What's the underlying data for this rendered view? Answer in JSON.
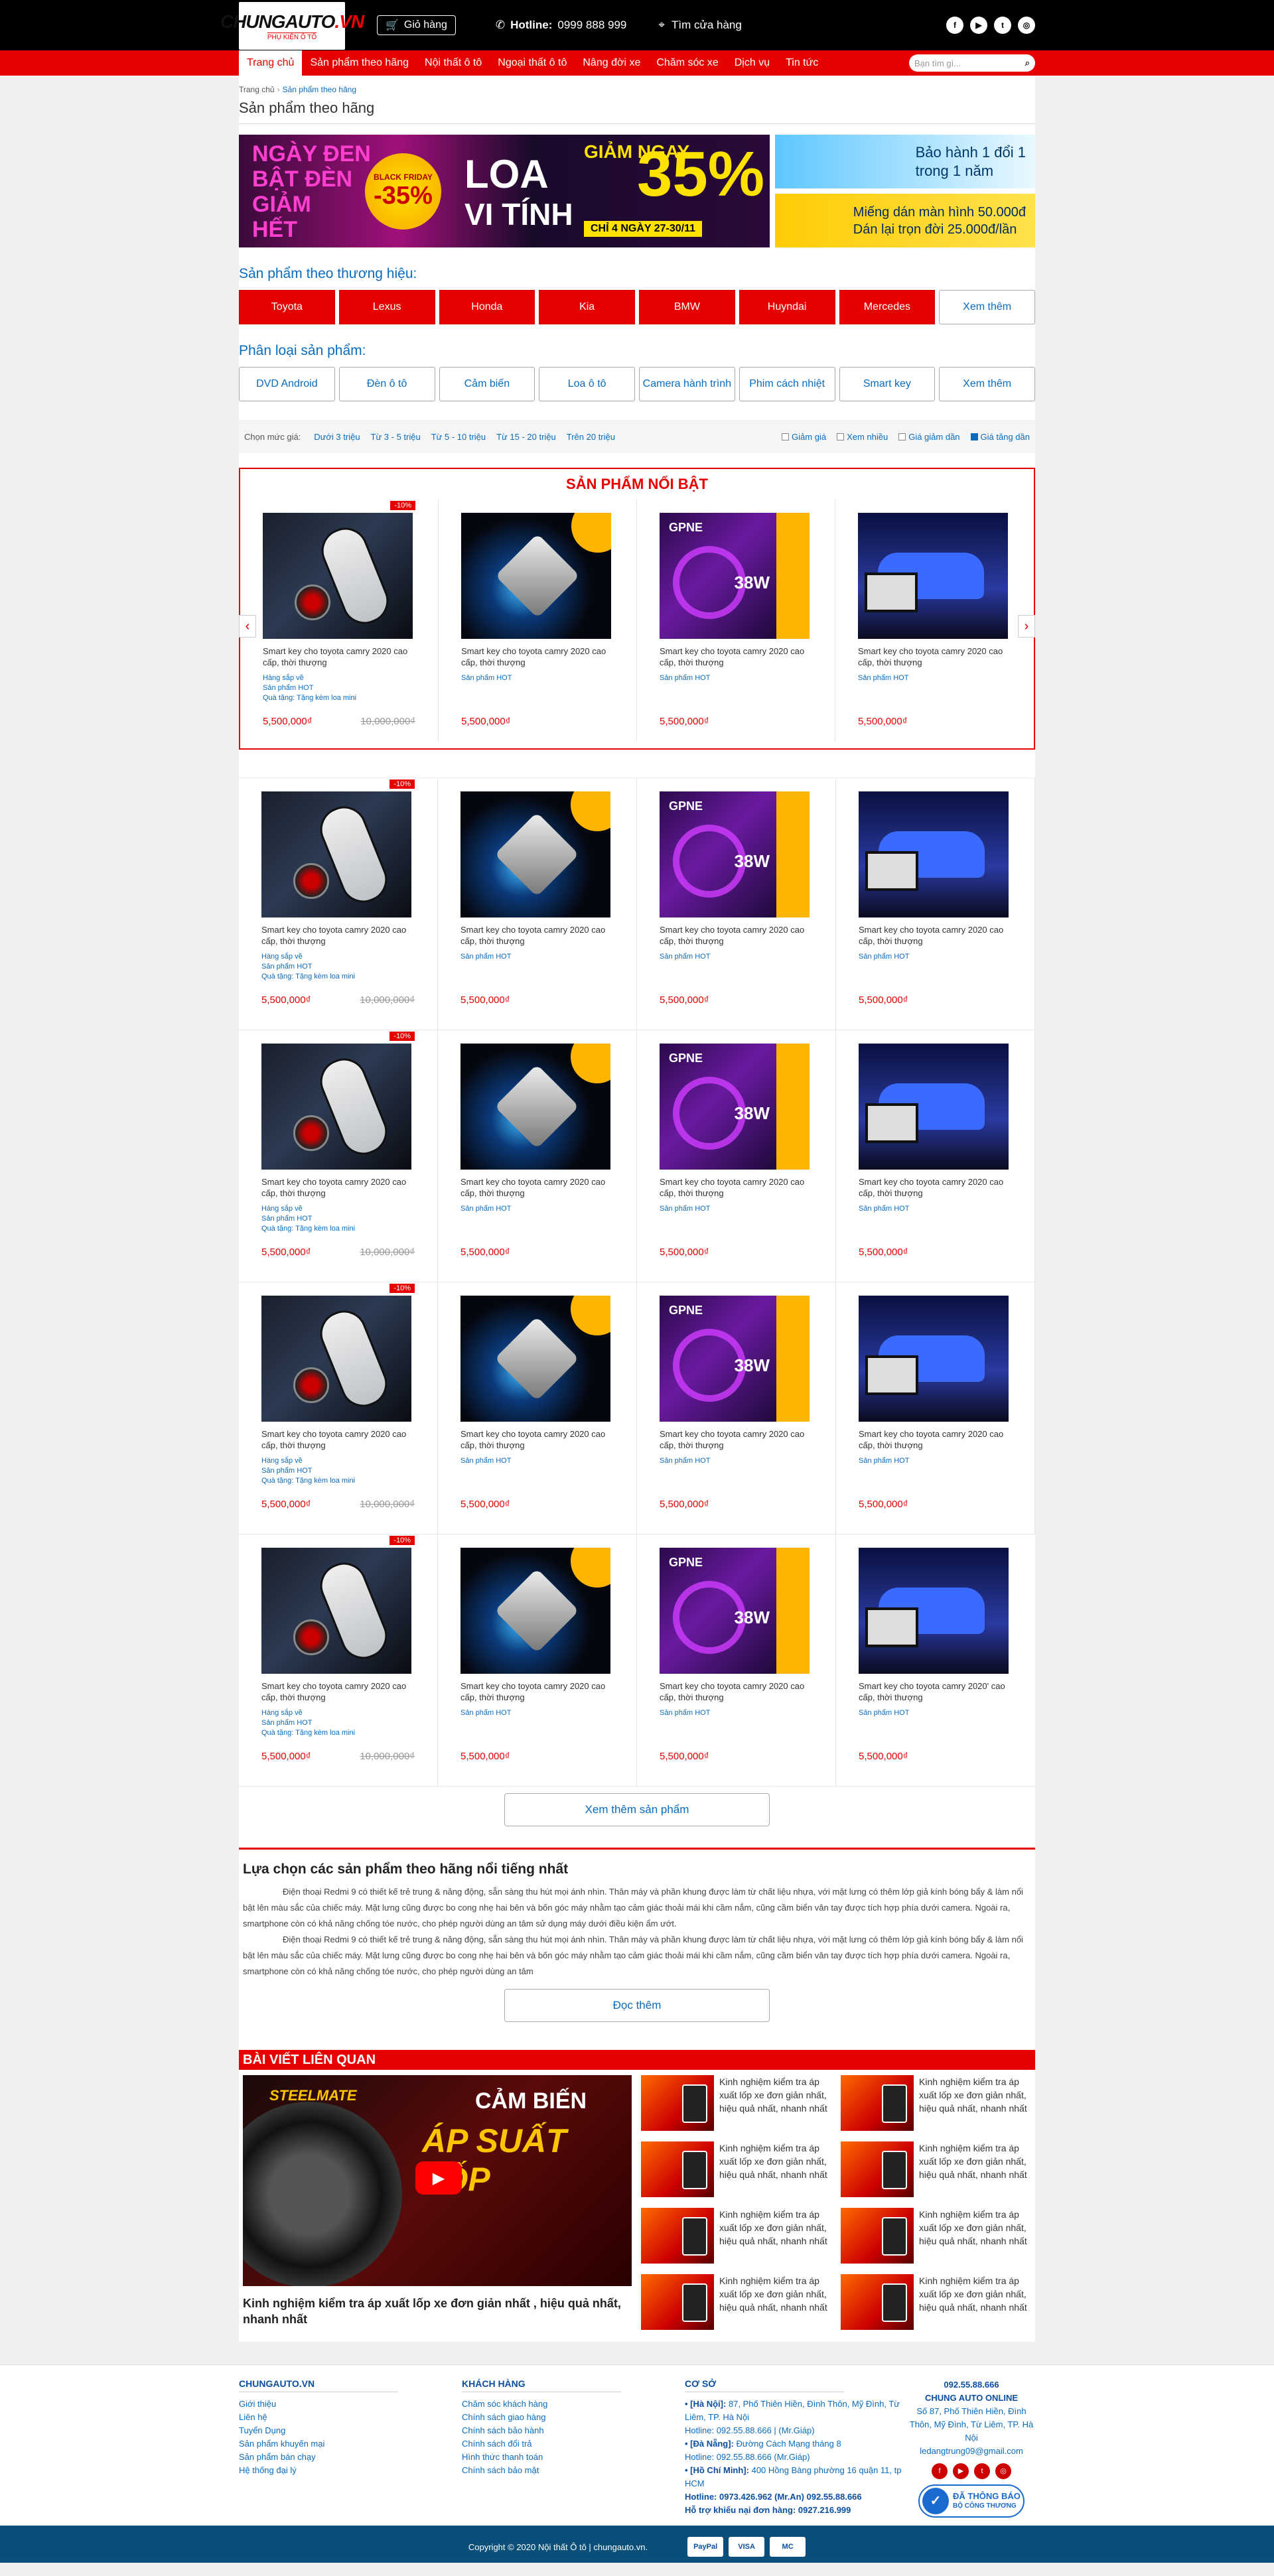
{
  "header": {
    "logo_main_1": "CHUNGAUTO",
    "logo_main_2": ".VN",
    "logo_sub": "PHỤ KIỆN Ô TÔ",
    "cart_label": "Giỏ hàng",
    "hotline_label": "Hotline:",
    "hotline_number": "0999 888 999",
    "store_label": "Tìm cửa hàng",
    "socials": [
      "f",
      "▶",
      "t",
      "◎"
    ]
  },
  "nav": {
    "items": [
      "Trang chủ",
      "Sản phẩm theo hãng",
      "Nội thất ô tô",
      "Ngoại thất ô tô",
      "Nâng đời xe",
      "Chăm sóc xe",
      "Dịch vụ",
      "Tin tức"
    ],
    "search_placeholder": "Bạn tìm gì..."
  },
  "breadcrumb": {
    "home": "Trang chủ",
    "current": "Sản phẩm theo hãng"
  },
  "page_title": "Sản phẩm theo hãng",
  "banner": {
    "big_l1": "NGÀY ĐEN",
    "big_l2": "BẬT ĐÈN",
    "big_l3": "GIẢM",
    "big_l4": "HẾT",
    "big_badge": "-35%",
    "big_badge_sub": "BLACK FRIDAY",
    "big_loa": "LOA",
    "big_vitinh": "VI TÍNH",
    "big_giam": "GIẢM NGAY",
    "big_pct": "35%",
    "big_date": "CHỈ 4 NGÀY 27-30/11",
    "s1_l1": "Bảo hành 1 đổi 1",
    "s1_l2": "trong 1 năm",
    "s2_l1": "Miếng dán màn hình 50.000đ",
    "s2_l2": "Dán lại trọn đời 25.000đ/lần"
  },
  "brands_title": "Sản phẩm theo thương hiệu:",
  "brands": [
    "Toyota",
    "Lexus",
    "Honda",
    "Kia",
    "BMW",
    "Huyndai",
    "Mercedes"
  ],
  "brands_more": "Xem thêm",
  "cats_title": "Phân loại sản phẩm:",
  "cats": [
    "DVD Android",
    "Đèn ô tô",
    "Cảm biến",
    "Loa ô tô",
    "Camera hành trình",
    "Phim cách nhiệt",
    "Smart key",
    "Xem thêm"
  ],
  "filter": {
    "label": "Chọn mức giá:",
    "ranges": [
      "Dưới 3 triệu",
      "Từ 3 - 5 triệu",
      "Từ 5 - 10 triệu",
      "Từ 15 - 20 triệu",
      "Trên 20 triệu"
    ],
    "sorts": [
      {
        "label": "Giảm giá",
        "checked": false
      },
      {
        "label": "Xem nhiều",
        "checked": false
      },
      {
        "label": "Giá giảm dần",
        "checked": false
      },
      {
        "label": "Giá tăng dần",
        "checked": true
      }
    ]
  },
  "featured_title": "SẢN PHẨM NỔI BẬT",
  "product_template": {
    "name": "Smart key cho toyota camry 2020 cao cấp, thời thượng",
    "name_last": "Smart key cho toyota camry 2020' cao cấp, thời thượng",
    "discount": "-10%",
    "tag_coming": "Hàng sắp về",
    "tag_hot": "Sản phẩm HOT",
    "tag_gift": "Quà tặng: Tặng kèm loa mini",
    "price": "5,500,000₫",
    "old_price": "10,000,000₫"
  },
  "load_more": "Xem thêm sản phẩm",
  "desc": {
    "title": "Lựa chọn các sản phẩm theo hãng nổi tiếng nhất",
    "p1": "Điện thoại Redmi 9 có thiết kế trẻ trung & năng động, sẵn sàng thu hút mọi ánh nhìn. Thân máy và phần khung được làm từ chất liệu nhựa, với mặt lưng có thêm lớp giả kính bóng bẩy & làm nổi bật lên màu sắc của chiếc máy. Mặt lưng cũng được bo cong nhẹ hai bên và bốn góc máy nhằm tạo cảm giác thoải mái khi cầm nắm, cũng cầm biển vân tay được tích hợp phía dưới camera. Ngoài ra, smartphone còn có khả năng chống tóe nước, cho phép người dùng an tâm sử dụng máy dưới điều kiện ẩm ướt.",
    "p2": "Điện thoại Redmi 9 có thiết kế trẻ trung & năng động, sẵn sàng thu hút mọi ánh nhìn. Thân máy và phần khung được làm từ chất liệu nhựa, với mặt lưng có thêm lớp giả kính bóng bẩy & làm nổi bật lên màu sắc của chiếc máy. Mặt lưng cũng được bo cong nhẹ hai bên và bốn góc máy nhằm tạo cảm giác thoải mái khi cầm nắm, cũng cầm biển vân tay được tích hợp phía dưới camera. Ngoài ra, smartphone còn có khả năng chống tóe nước, cho phép người dùng an tâm",
    "read_more": "Đọc thêm"
  },
  "related": {
    "title": "BÀI VIẾT LIÊN QUAN",
    "big_brand": "STEELMATE",
    "big_t1": "CẢM BIẾN",
    "big_t2": "ÁP SUẤT LỐP",
    "big_caption": "Kinh nghiệm kiểm tra áp xuất lốp xe đơn giản nhất , hiệu quả nhất, nhanh nhất",
    "item_text": "Kinh nghiệm kiểm tra áp xuất lốp xe đơn giản nhất, hiệu quả nhất, nhanh nhất"
  },
  "footer": {
    "c1_title": "CHUNGAUTO.VN",
    "c1_links": [
      "Giới thiệu",
      "Liên hệ",
      "Tuyển Dụng",
      "Sản phẩm khuyến mại",
      "Sản phẩm bán chạy",
      "Hệ thống đại lý"
    ],
    "c2_title": "KHÁCH HÀNG",
    "c2_links": [
      "Chăm sóc khách hàng",
      "Chính sách giao hàng",
      "Chính sách bảo hành",
      "Chính sách đổi trả",
      "Hình thức thanh toán",
      "Chính sách bảo mật"
    ],
    "c3_title": "CƠ SỞ",
    "hn_label": "• [Hà Nội]:",
    "hn_addr": "87, Phố Thiên Hiền, Đình Thôn, Mỹ Đình, Từ Liêm, TP. Hà Nội",
    "hn_hotline": "Hotline: 092.55.88.666 | (Mr.Giáp)",
    "dn_label": "• [Đà Nẵng]:",
    "dn_addr": "Đường Cách Mạng tháng 8",
    "dn_hotline": "Hotline: 092.55.88.666 (Mr.Giáp)",
    "hcm_label": "• [Hồ Chí Minh]:",
    "hcm_addr": "400 Hồng Bàng phường 16 quận 11, tp HCM",
    "hcm_hotline": "Hotline: 0973.426.962 (Mr.An) 092.55.88.666",
    "support": "Hỗ trợ khiếu nại đơn hàng: 0927.216.999",
    "r_phone": "092.55.88.666",
    "r_name": "CHUNG AUTO ONLINE",
    "r_addr": "Số 87, Phố Thiên Hiền, Đình Thôn, Mỹ Đình, Từ Liêm, TP. Hà Nội",
    "r_email": "ledangtrung09@gmail.com",
    "badge_l1": "ĐÃ THÔNG BÁO",
    "badge_l2": "BỘ CÔNG THƯƠNG",
    "copyright": "Copyright © 2020 Nội thất Ô tô | chungauto.vn.",
    "pay": [
      "PayPal",
      "VISA",
      "MC"
    ]
  }
}
